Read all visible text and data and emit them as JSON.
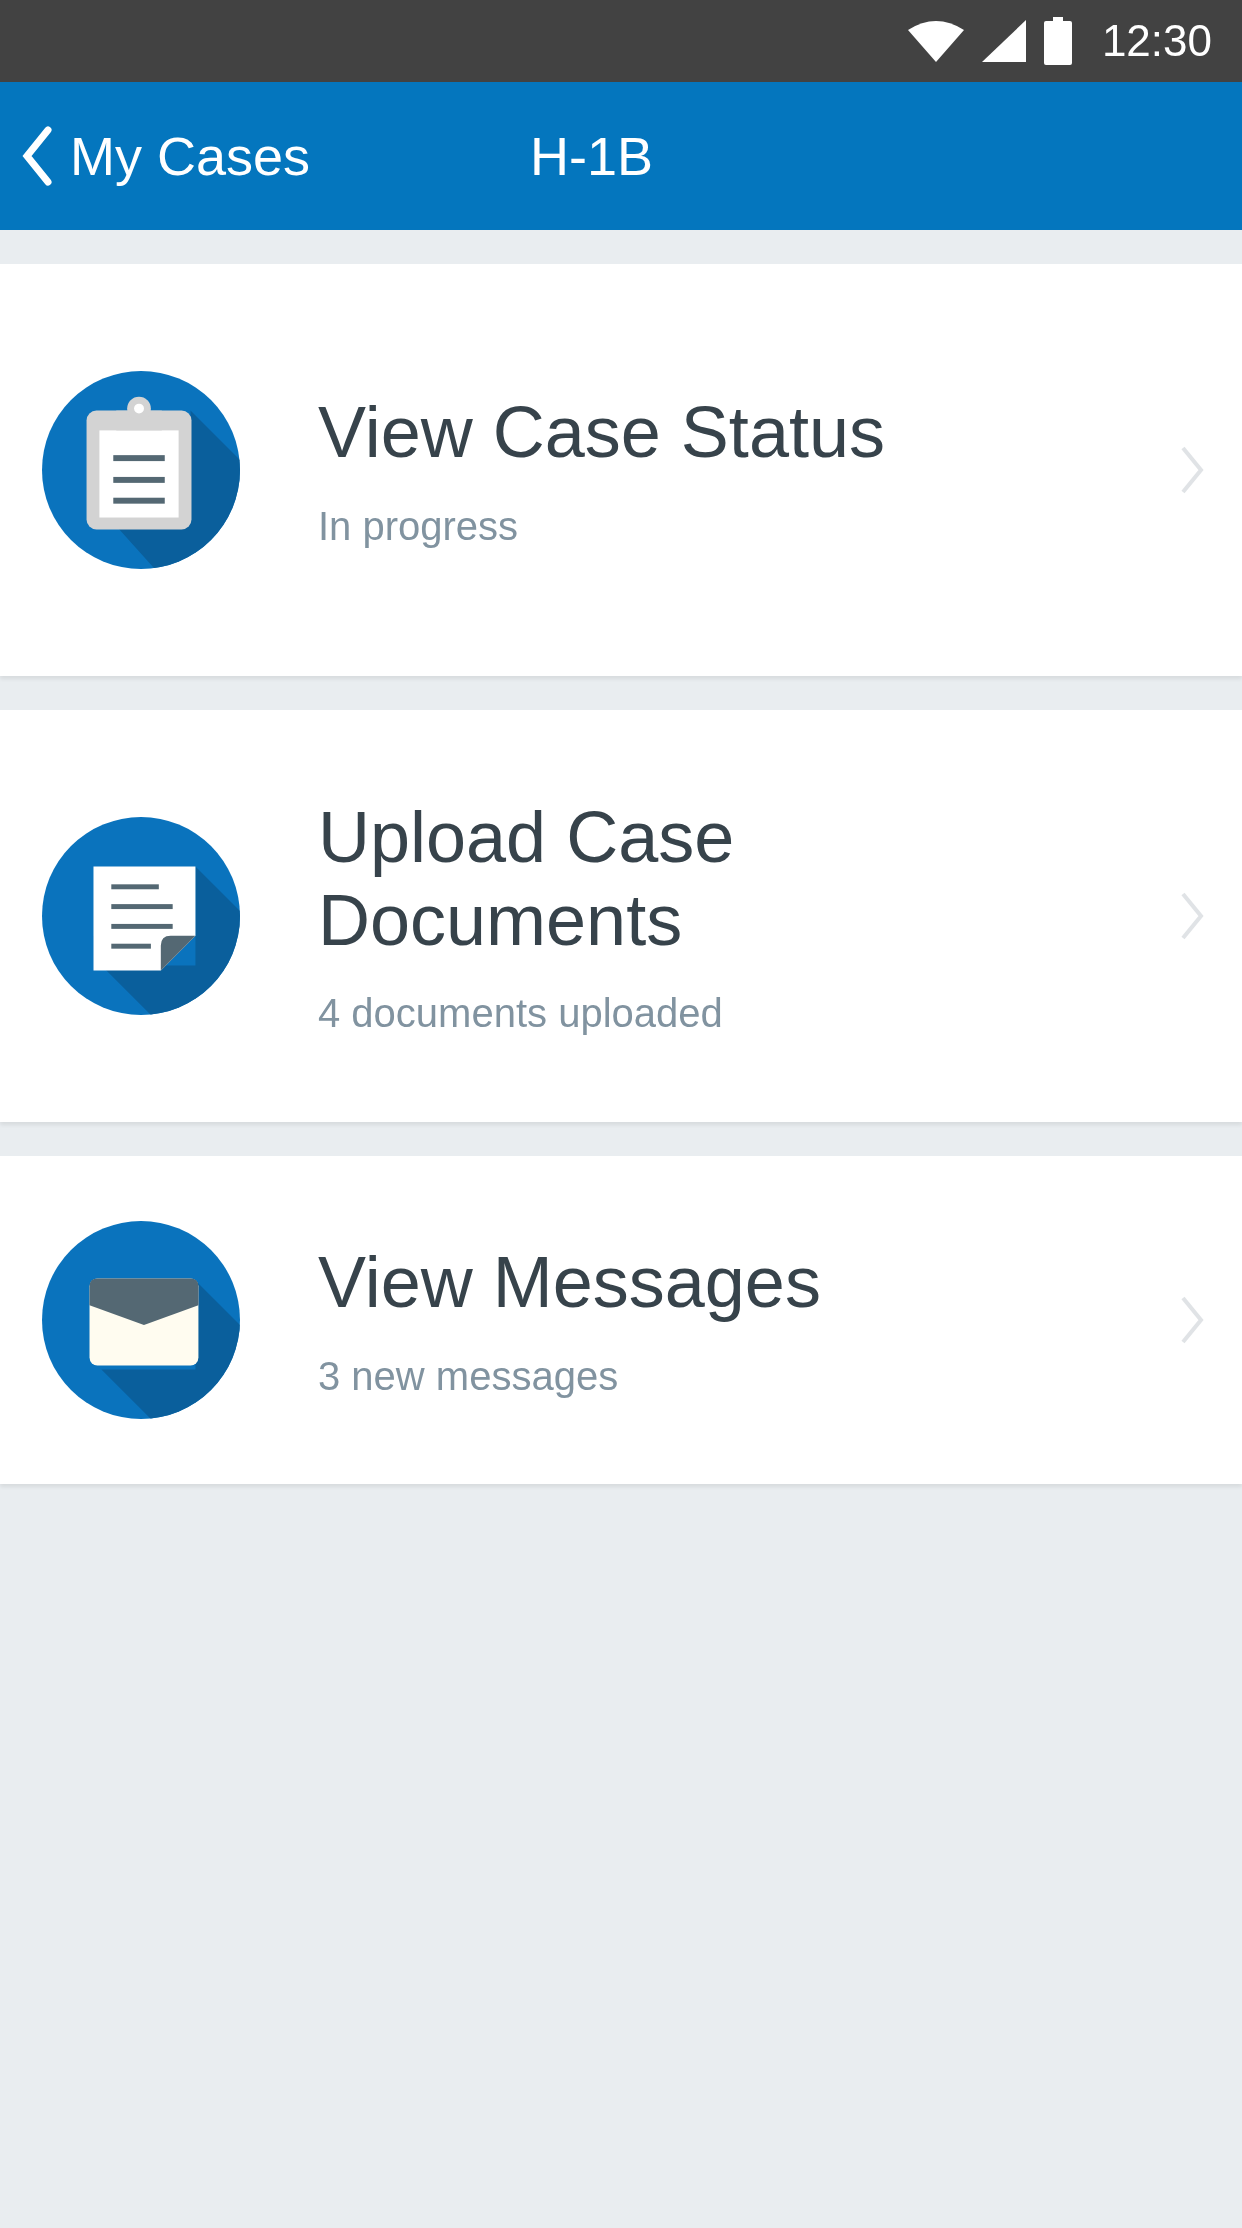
{
  "status_bar": {
    "time": "12:30"
  },
  "app_bar": {
    "back_label": "My Cases",
    "title": "H-1B"
  },
  "items": [
    {
      "kind": "clipboard",
      "title": "View Case Status",
      "subtitle": "In progress"
    },
    {
      "kind": "document",
      "title": "Upload Case Documents",
      "subtitle": "4 documents uploaded"
    },
    {
      "kind": "envelope",
      "title": "View Messages",
      "subtitle": "3 new messages"
    }
  ]
}
